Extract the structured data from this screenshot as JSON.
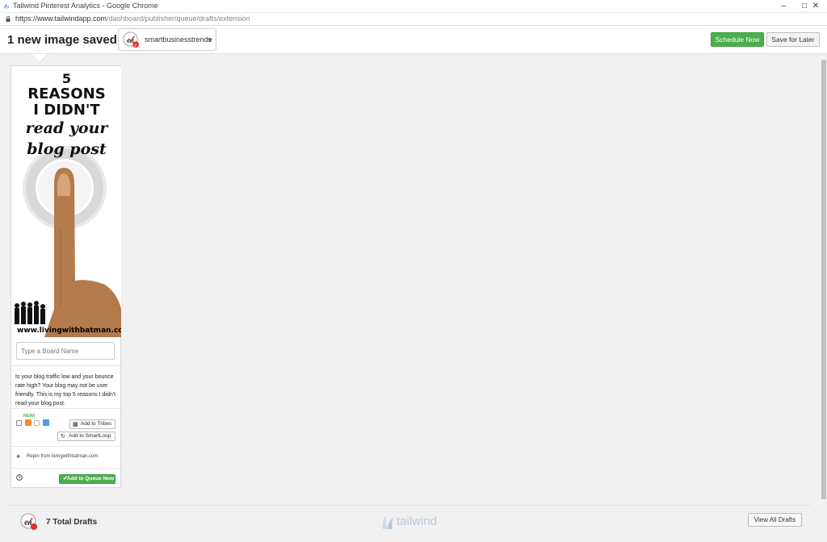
{
  "window": {
    "title": "Tailwind Pinterest Analytics - Google Chrome",
    "controls": [
      "–",
      "□",
      "✕"
    ]
  },
  "address": {
    "url_host": "https://www.tailwindapp.com",
    "url_path": "/dashboard/publisher/queue/drafts/extension"
  },
  "header": {
    "title": "1 new image saved!",
    "account_name": "smartbusinesstrends",
    "schedule_label": "Schedule Now",
    "save_later_label": "Save for Later"
  },
  "pin": {
    "image_lines": [
      "5",
      "REASONS",
      "I DIDN'T",
      "read your",
      "blog post"
    ],
    "watermark": "www.livingwithbatman.com",
    "board_placeholder": "Type a Board Name",
    "description": "Is your blog traffic low and your bounce rate high? Your blog may not be user friendly. This is my top 5 reasons I didn't read your blog post.",
    "new_label": "NEW!",
    "add_tribes_label": "Add to Tribes",
    "add_smartloop_label": "Add to SmartLoop",
    "repin_text": "Repin from livingwithbatman.com",
    "queue_label": "Add to Queue Now"
  },
  "footer": {
    "total_drafts": "7 Total Drafts",
    "logo_text": "tailwind",
    "view_all_label": "View All Drafts"
  },
  "colors": {
    "green": "#4cae4c",
    "logo_blue": "#b7cbe0"
  }
}
